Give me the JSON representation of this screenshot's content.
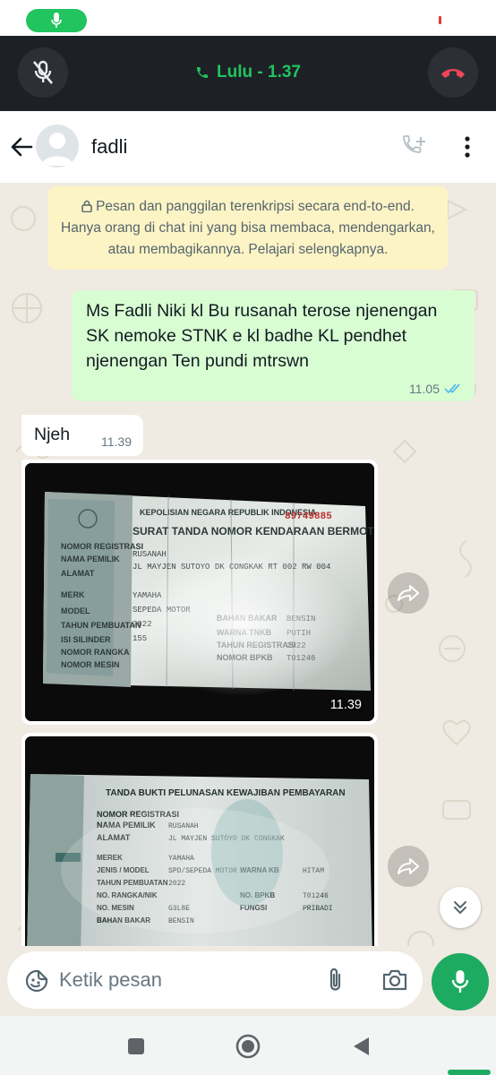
{
  "call": {
    "caller": "Lulu - 1.37",
    "accent_color": "#21c45e",
    "end_color": "#f0455a"
  },
  "header": {
    "contact_name": "fadli",
    "back_icon": "arrow-left-icon",
    "add_call_icon": "add-call-icon",
    "menu_icon": "more-vertical-icon"
  },
  "chat": {
    "encryption_notice": "Pesan dan panggilan terenkripsi secara end-to-end. Hanya orang di chat ini yang bisa membaca, mendengarkan, atau membagikannya. Pelajari selengkapnya.",
    "messages": [
      {
        "direction": "outgoing",
        "text": "Ms Fadli Niki kl Bu rusanah terose njenengan SK nemoke STNK e kl badhe KL pendhet njenengan Ten pundi mtrswn",
        "time": "11.05",
        "status": "read"
      },
      {
        "direction": "incoming",
        "text": "Njeh",
        "time": "11.39"
      },
      {
        "direction": "incoming",
        "type": "image",
        "caption_icon": "photo-of-vehicle-registration-document",
        "time": "11.39"
      },
      {
        "direction": "incoming",
        "type": "image",
        "caption_icon": "photo-of-tax-payment-receipt",
        "time": ""
      }
    ]
  },
  "composer": {
    "placeholder": "Ketik pesan",
    "accent_color": "#1daa61"
  }
}
